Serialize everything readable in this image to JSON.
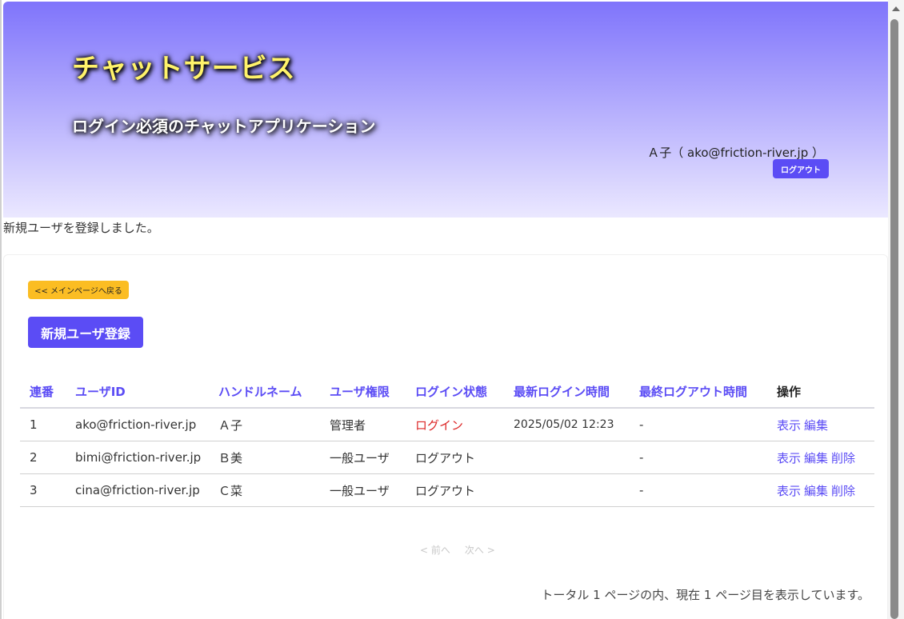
{
  "header": {
    "brand": "チャットサービス",
    "tagline": "ログイン必須のチャットアプリケーション",
    "user_info": "Ａ子（ ako@friction-river.jp ）",
    "logout_label": "ログアウト"
  },
  "flash_message": "新規ユーザを登録しました。",
  "actions": {
    "back_label": "<< メインページへ戻る",
    "new_user_label": "新規ユーザ登録"
  },
  "table": {
    "columns": [
      "連番",
      "ユーザID",
      "ハンドルネーム",
      "ユーザ権限",
      "ログイン状態",
      "最新ログイン時間",
      "最終ログアウト時間",
      "操作"
    ],
    "rows": [
      {
        "no": "1",
        "user_id": "ako@friction-river.jp",
        "handle": "Ａ子",
        "role": "管理者",
        "status": "ログイン",
        "last_login": "2025/05/02 12:23",
        "last_logout": "-"
      },
      {
        "no": "2",
        "user_id": "bimi@friction-river.jp",
        "handle": "Ｂ美",
        "role": "一般ユーザ",
        "status": "ログアウト",
        "last_login": "",
        "last_logout": "-"
      },
      {
        "no": "3",
        "user_id": "cina@friction-river.jp",
        "handle": "Ｃ菜",
        "role": "一般ユーザ",
        "status": "ログアウト",
        "last_login": "",
        "last_logout": "-"
      }
    ],
    "op_labels": {
      "show": "表示",
      "edit": "編集",
      "delete": "削除"
    }
  },
  "pager": {
    "prev": "< 前へ",
    "next": "次へ >"
  },
  "total_text": "トータル 1 ページの内、現在 1 ページ目を表示しています。",
  "colors": {
    "accent": "#5b4cf5",
    "warning": "#fbbd23",
    "status_login": "#dc2626",
    "brand_text": "#fff36a"
  }
}
